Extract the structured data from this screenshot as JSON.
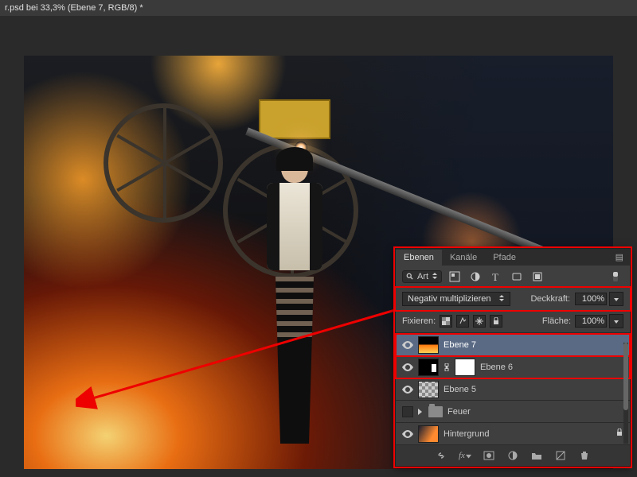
{
  "titlebar": "r.psd bei 33,3% (Ebene 7, RGB/8) *",
  "panel": {
    "tabs": [
      "Ebenen",
      "Kanäle",
      "Pfade"
    ],
    "active_tab": 0,
    "filter_label": "Art",
    "blend_mode": "Negativ multiplizieren",
    "opacity_label": "Deckkraft:",
    "opacity_value": "100%",
    "lock_label": "Fixieren:",
    "fill_label": "Fläche:",
    "fill_value": "100%"
  },
  "layers": [
    {
      "name": "Ebene 7",
      "visible": true,
      "thumb": "fire",
      "selected": true,
      "highlight": true
    },
    {
      "name": "Ebene 6",
      "visible": true,
      "thumb": "blackmask",
      "hasMask": true,
      "highlight": true
    },
    {
      "name": "Ebene 5",
      "visible": true,
      "thumb": "checker"
    },
    {
      "name": "Feuer",
      "visible": false,
      "isGroup": true
    },
    {
      "name": "Hintergrund",
      "visible": true,
      "thumb": "bg",
      "locked": true
    }
  ]
}
